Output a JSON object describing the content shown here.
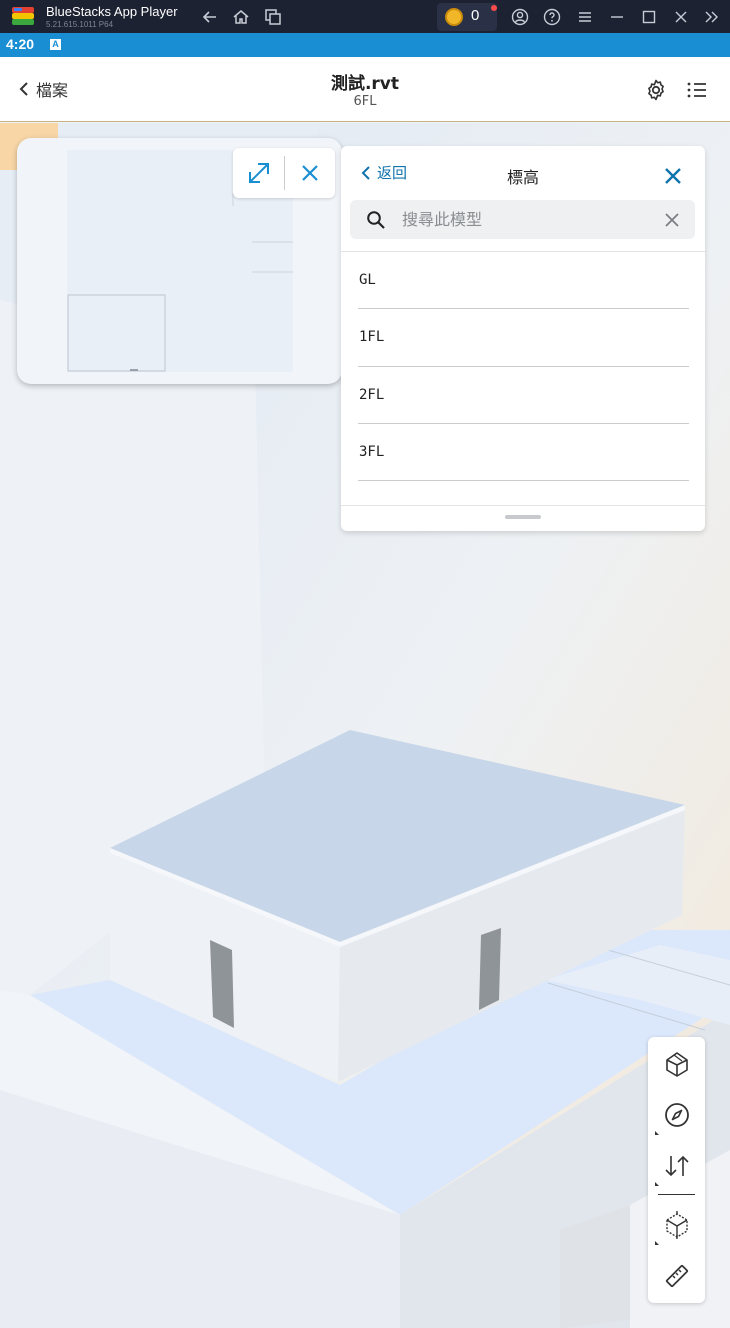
{
  "emulator": {
    "title": "BlueStacks App Player",
    "version": "5.21.615.1011 P64",
    "coins": "0",
    "icons": [
      "back-icon",
      "home-icon",
      "recent-apps-icon",
      "account-icon",
      "help-icon",
      "menu-icon",
      "minimize-icon",
      "maximize-icon",
      "close-icon",
      "expand-sidebar-icon"
    ]
  },
  "status_bar": {
    "time": "4:20",
    "indicator": "A"
  },
  "header": {
    "back_label": "檔案",
    "file_name": "測試.rvt",
    "level_name": "6FL",
    "icons": [
      "settings-icon",
      "list-icon"
    ]
  },
  "levels_panel": {
    "back_label": "返回",
    "title": "標高",
    "search_placeholder": "搜尋此模型",
    "levels": [
      {
        "label": "GL"
      },
      {
        "label": "1FL"
      },
      {
        "label": "2FL"
      },
      {
        "label": "3FL"
      }
    ]
  },
  "toolbar": {
    "tools": [
      "view-cube-icon",
      "compass-icon",
      "elevation-icon",
      "section-box-icon",
      "measure-icon"
    ]
  },
  "colors": {
    "accent": "#1a8ed3",
    "link": "#1073ad",
    "sidebar_toggle": "#f8d6a6",
    "header_border": "#c8b283",
    "emulator_bar": "#1d2232"
  }
}
